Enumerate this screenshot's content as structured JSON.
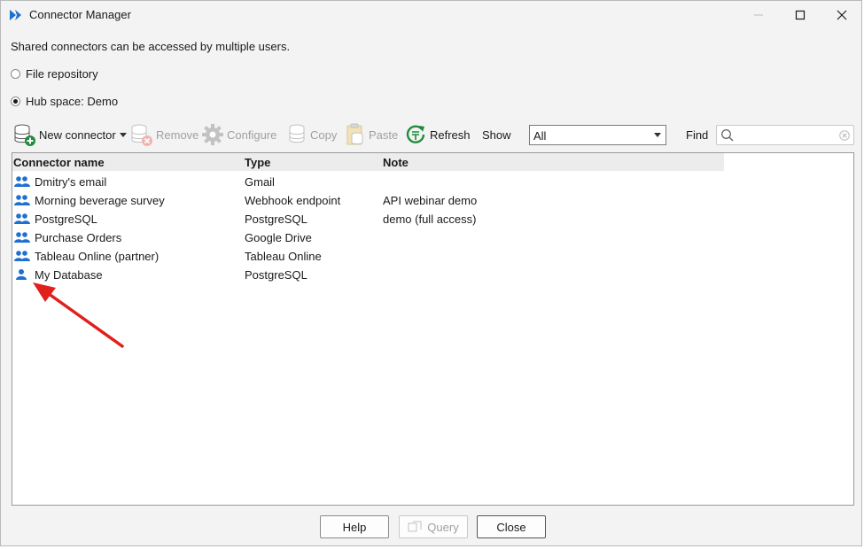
{
  "window": {
    "title": "Connector Manager"
  },
  "description": "Shared connectors can be accessed by multiple users.",
  "radios": [
    {
      "label": "File repository",
      "checked": false
    },
    {
      "label": "Hub space: Demo",
      "checked": true
    }
  ],
  "toolbar": {
    "new_connector": "New connector",
    "remove": "Remove",
    "configure": "Configure",
    "copy": "Copy",
    "paste": "Paste",
    "refresh": "Refresh",
    "show_label": "Show",
    "show_value": "All",
    "find_label": "Find",
    "find_value": ""
  },
  "table": {
    "columns": [
      "Connector name",
      "Type",
      "Note"
    ],
    "rows": [
      {
        "icon": "shared-users-icon",
        "name": "Dmitry's email",
        "type": "Gmail",
        "note": ""
      },
      {
        "icon": "shared-users-icon",
        "name": "Morning beverage survey",
        "type": "Webhook endpoint",
        "note": "API webinar demo"
      },
      {
        "icon": "shared-users-icon",
        "name": "PostgreSQL",
        "type": "PostgreSQL",
        "note": "demo (full access)"
      },
      {
        "icon": "shared-users-icon",
        "name": "Purchase Orders",
        "type": "Google Drive",
        "note": ""
      },
      {
        "icon": "shared-users-icon",
        "name": "Tableau Online (partner)",
        "type": "Tableau Online",
        "note": ""
      },
      {
        "icon": "single-user-icon",
        "name": "My Database",
        "type": "PostgreSQL",
        "note": ""
      }
    ]
  },
  "buttons": {
    "help": "Help",
    "query": "Query",
    "close": "Close"
  },
  "colors": {
    "accent": "#1f6fd1",
    "annotation_arrow": "#e0201b",
    "refresh_green": "#1e8c3a"
  }
}
